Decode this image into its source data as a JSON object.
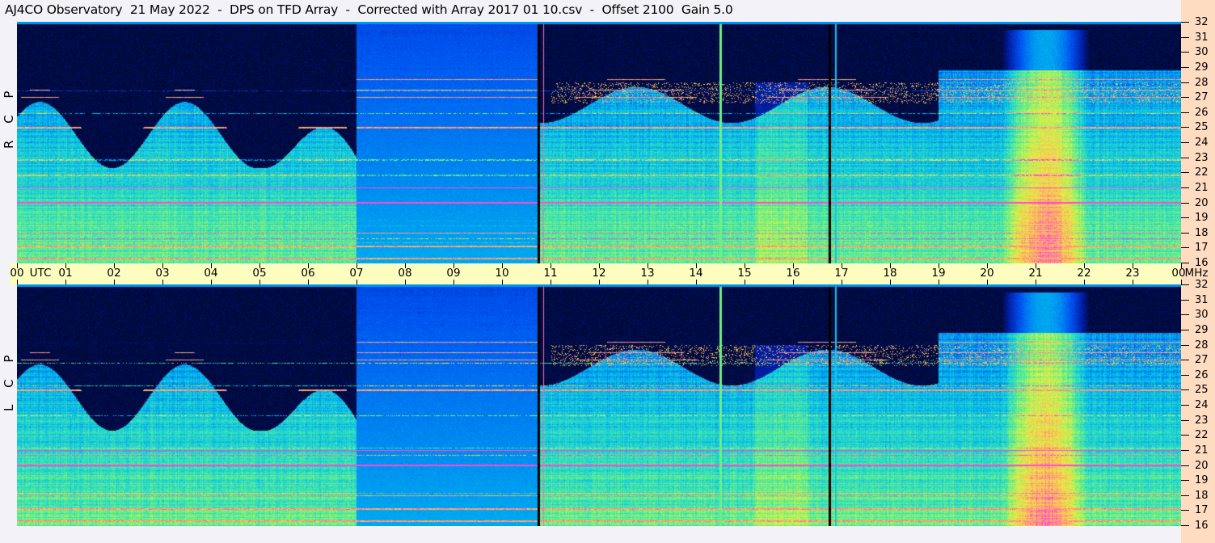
{
  "title": "AJ4CO Observatory  21 May 2022  -  DPS on TFD Array  -  Corrected with Array 2017 01 10.csv  -  Offset 2100  Gain 5.0",
  "chart_data": {
    "type": "heatmap",
    "subtype": "dynamic spectrogram",
    "panels": [
      {
        "name": "RCP",
        "label": "R C P"
      },
      {
        "name": "LCP",
        "label": "L C P"
      }
    ],
    "x_axis": {
      "unit_label": "UTC",
      "range_hours": [
        0,
        24
      ],
      "ticks": [
        "00",
        "01",
        "02",
        "03",
        "04",
        "05",
        "06",
        "07",
        "08",
        "09",
        "10",
        "11",
        "12",
        "13",
        "14",
        "15",
        "16",
        "17",
        "18",
        "19",
        "20",
        "21",
        "22",
        "23",
        "00"
      ]
    },
    "y_axis": {
      "unit_label": "MHz",
      "range": [
        16,
        32
      ],
      "ticks": [
        32,
        31,
        30,
        29,
        28,
        27,
        26,
        25,
        24,
        23,
        22,
        21,
        20,
        19,
        18,
        17,
        16
      ]
    },
    "colormap": [
      "#000000",
      "#001a9c",
      "#0050f0",
      "#00a8f0",
      "#20d8d0",
      "#70f080",
      "#e8f040",
      "#ffb060",
      "#ff40e0",
      "#ffffff"
    ],
    "features": {
      "bright_band_utc": [
        20.3,
        22.1
      ],
      "vertical_lines_utc": [
        10.75,
        10.85,
        14.5,
        14.6,
        16.75,
        16.85
      ]
    }
  },
  "colors": {
    "background": "#f3f3f7",
    "time_band": "#fdfdc0",
    "right_strip": "#fddcc2"
  }
}
